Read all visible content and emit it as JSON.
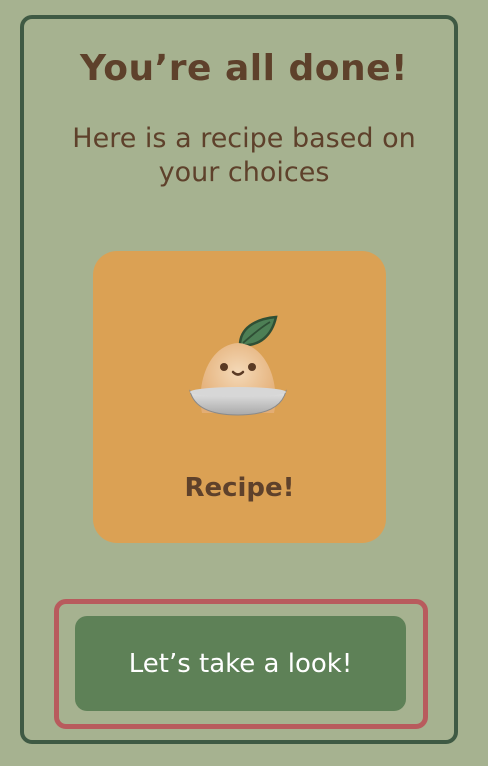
{
  "colors": {
    "background": "#a6b290",
    "panel_border": "#3f5a44",
    "text": "#5e412b",
    "card": "#dba154",
    "button": "#5e8157",
    "highlight": "#b85b5d"
  },
  "heading": {
    "title": "You’re all done!",
    "subtitle": "Here is a recipe based on your choices"
  },
  "recipe_card": {
    "icon": "sprout-mascot-icon",
    "label": "Recipe!"
  },
  "actions": {
    "look_button": "Let’s take a look!"
  }
}
